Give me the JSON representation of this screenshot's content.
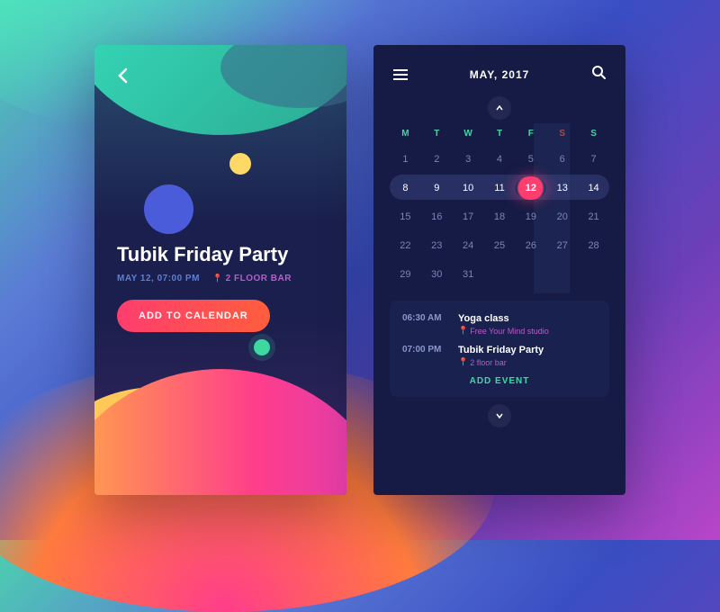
{
  "event_detail": {
    "title": "Tubik Friday Party",
    "date": "MAY 12, 07:00 PM",
    "location": "2 FLOOR BAR",
    "add_button": "ADD TO CALENDAR"
  },
  "calendar": {
    "month_label": "MAY, 2017",
    "weekdays": [
      "M",
      "T",
      "W",
      "T",
      "F",
      "S",
      "S"
    ],
    "weeks": [
      [
        1,
        2,
        3,
        4,
        5,
        6,
        7
      ],
      [
        8,
        9,
        10,
        11,
        12,
        13,
        14
      ],
      [
        15,
        16,
        17,
        18,
        19,
        20,
        21
      ],
      [
        22,
        23,
        24,
        25,
        26,
        27,
        28
      ],
      [
        29,
        30,
        31
      ]
    ],
    "selected_day": 12,
    "highlighted_week_index": 1,
    "highlighted_column_index": 4
  },
  "day_events": [
    {
      "time": "06:30 AM",
      "name": "Yoga class",
      "place": "Free Your Mind studio"
    },
    {
      "time": "07:00 PM",
      "name": "Tubik Friday Party",
      "place": "2 floor bar"
    }
  ],
  "add_event_label": "ADD EVENT"
}
